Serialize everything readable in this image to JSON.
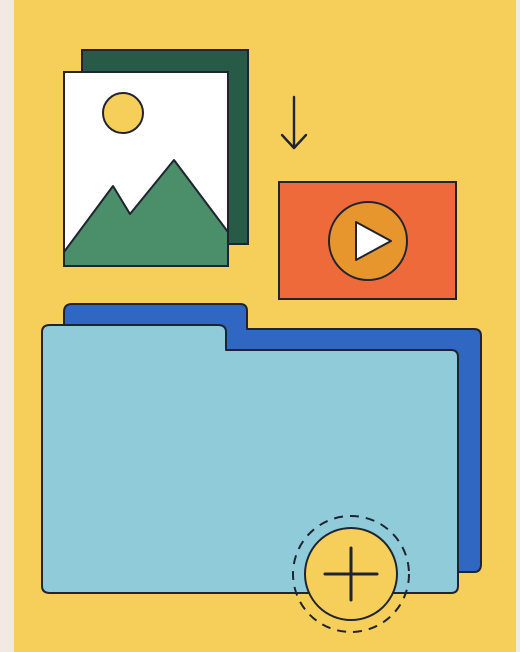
{
  "illustration": {
    "icons": {
      "image": "image-icon",
      "download_arrow": "arrow-down-icon",
      "video": "play-icon",
      "folder": "folder-icon",
      "add": "plus-icon"
    },
    "colors": {
      "background": "#f6cf5b",
      "outer_background": "#f3e9e4",
      "photo_shadow": "#285b47",
      "photo_card": "#ffffff",
      "sun": "#f6cf5b",
      "mountain": "#4b8f6a",
      "video_card": "#ee6a3a",
      "play_circle": "#e7962d",
      "play_triangle": "#ffffff",
      "folder_back": "#2f67c2",
      "folder_front": "#8fcbd9",
      "add_button": "#f6cf5b",
      "outline": "#1f2430"
    }
  }
}
